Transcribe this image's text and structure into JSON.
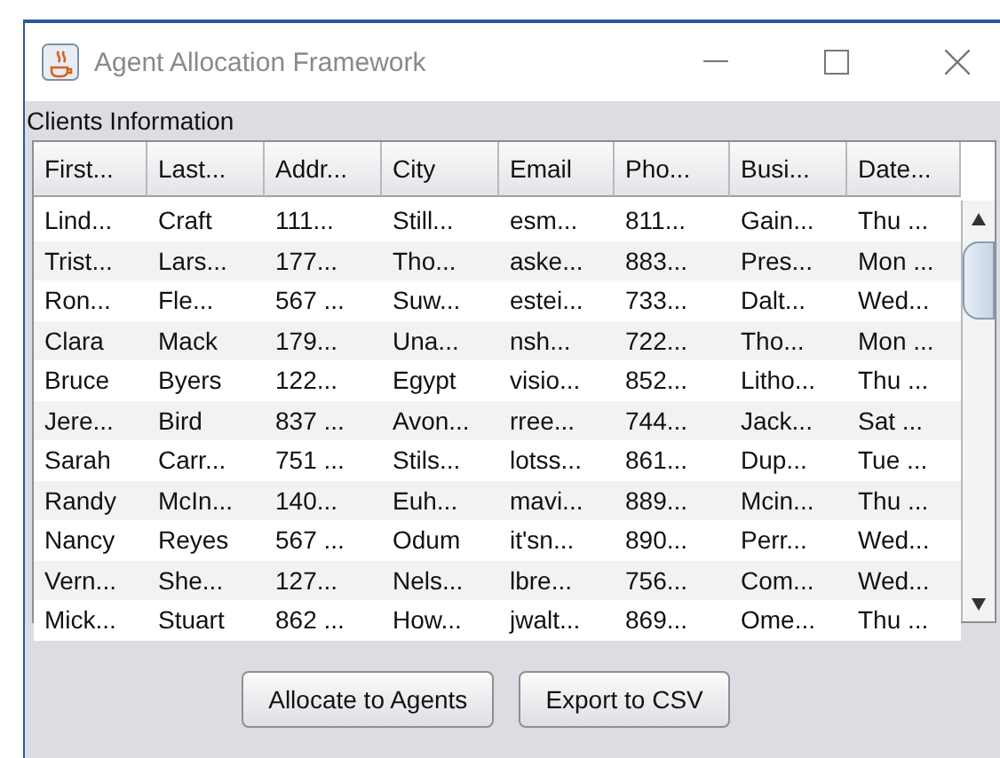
{
  "window": {
    "title": "Agent Allocation Framework"
  },
  "section_title": "Clients Information",
  "table": {
    "columns": [
      "First...",
      "Last...",
      "Addr...",
      "City",
      "Email",
      "Pho...",
      "Busi...",
      "Date..."
    ],
    "rows": [
      [
        "Lind...",
        "Craft",
        "111...",
        "Still...",
        "esm...",
        "811...",
        "Gain...",
        "Thu ..."
      ],
      [
        "Trist...",
        "Lars...",
        "177...",
        "Tho...",
        "aske...",
        "883...",
        "Pres...",
        "Mon ..."
      ],
      [
        "Ron...",
        "Fle...",
        "567 ...",
        "Suw...",
        "estei...",
        "733...",
        "Dalt...",
        "Wed..."
      ],
      [
        "Clara",
        "Mack",
        "179...",
        "Una...",
        "nsh...",
        "722...",
        "Tho...",
        "Mon ..."
      ],
      [
        "Bruce",
        "Byers",
        "122...",
        "Egypt",
        "visio...",
        "852...",
        "Litho...",
        "Thu ..."
      ],
      [
        "Jere...",
        "Bird",
        "837 ...",
        "Avon...",
        "rree...",
        "744...",
        "Jack...",
        "Sat ..."
      ],
      [
        "Sarah",
        "Carr...",
        "751 ...",
        "Stils...",
        "lotss...",
        "861...",
        "Dup...",
        "Tue ..."
      ],
      [
        "Randy",
        "McIn...",
        "140...",
        "Euh...",
        "mavi...",
        "889...",
        "Mcin...",
        "Thu ..."
      ],
      [
        "Nancy",
        "Reyes",
        "567 ...",
        "Odum",
        "it'sn...",
        "890...",
        "Perr...",
        "Wed..."
      ],
      [
        "Vern...",
        "She...",
        "127...",
        "Nels...",
        "lbre...",
        "756...",
        "Com...",
        "Wed..."
      ],
      [
        "Mick...",
        "Stuart",
        "862 ...",
        "How...",
        "jwalt...",
        "869...",
        "Ome...",
        "Thu ..."
      ]
    ]
  },
  "buttons": [
    "Allocate to Agents",
    "Export to CSV"
  ]
}
